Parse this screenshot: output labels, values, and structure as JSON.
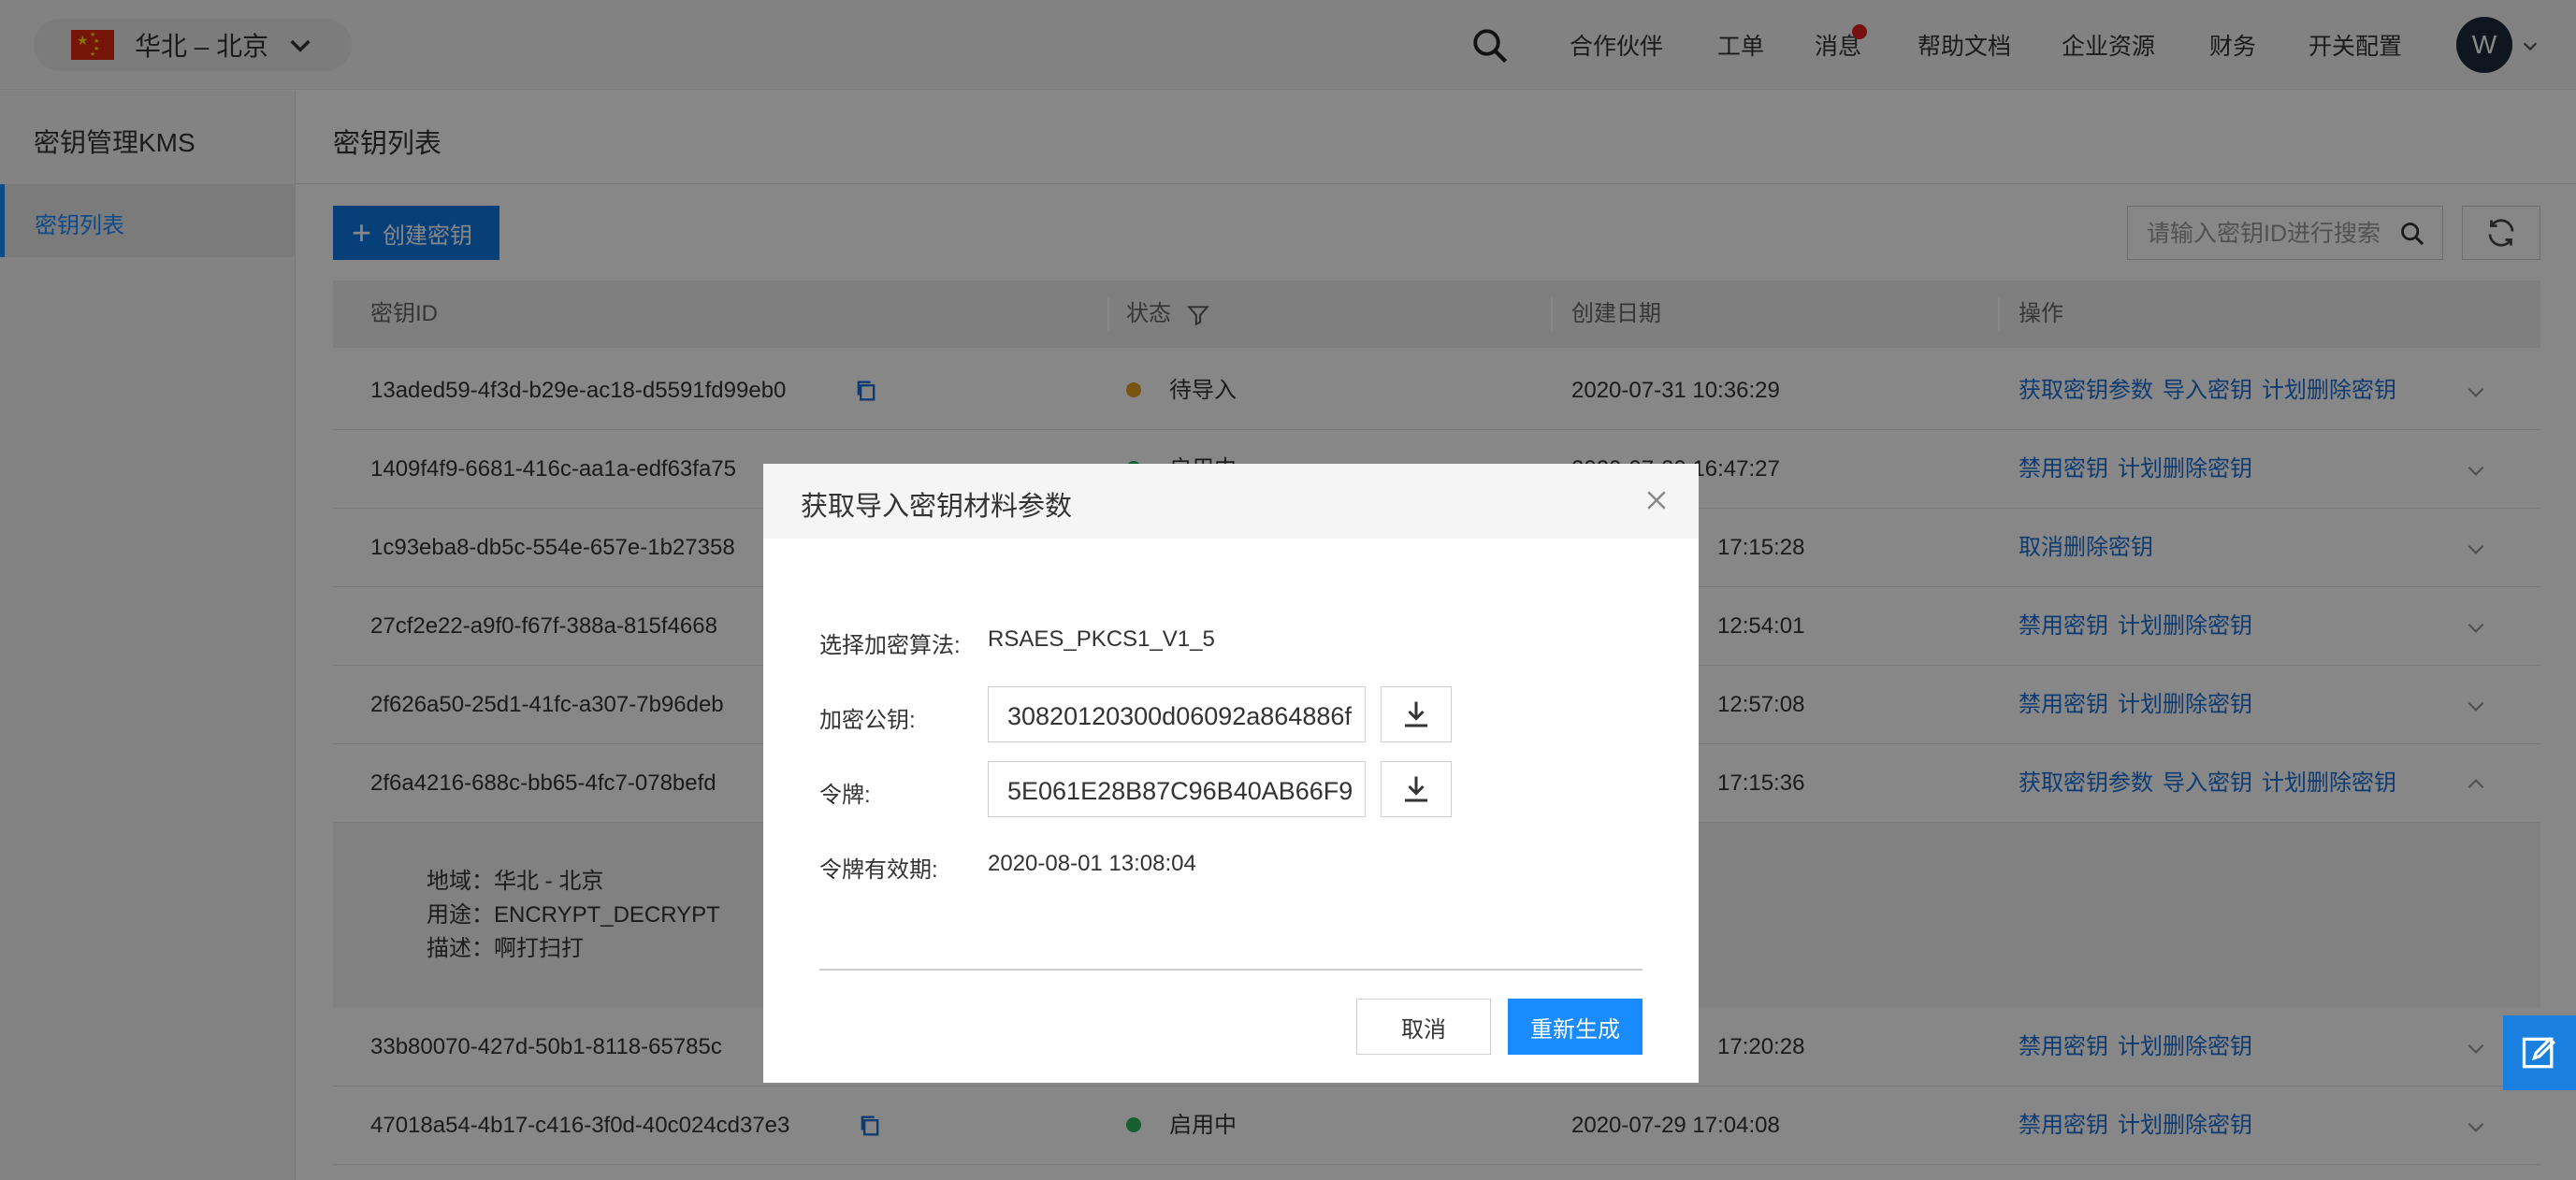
{
  "topbar": {
    "region": "华北 – 北京",
    "nav": [
      "合作伙伴",
      "工单",
      "消息",
      "帮助文档",
      "企业资源",
      "财务",
      "开关配置"
    ],
    "avatar_letter": "W"
  },
  "sidebar": {
    "title": "密钥管理KMS",
    "items": [
      {
        "label": "密钥列表"
      }
    ]
  },
  "main": {
    "page_title": "密钥列表",
    "create_button": "创建密钥",
    "search_placeholder": "请输入密钥ID进行搜索"
  },
  "table": {
    "headers": [
      "密钥ID",
      "状态",
      "创建日期",
      "操作"
    ],
    "rows": [
      {
        "id": "13aded59-4f3d-b29e-ac18-d5591fd99eb0",
        "status": "待导入",
        "status_color": "#e0a020",
        "date": "2020-07-31 10:36:29",
        "ops": [
          "获取密钥参数",
          "导入密钥",
          "计划删除密钥"
        ]
      },
      {
        "id": "1409f4f9-6681-416c-aa1a-edf63fa75",
        "status": "启用中",
        "status_color": "#2bb35a",
        "date": "2020-07-30 16:47:27",
        "ops": [
          "禁用密钥",
          "计划删除密钥"
        ]
      },
      {
        "id": "1c93eba8-db5c-554e-657e-1b27358",
        "status": "",
        "status_color": "",
        "date": "17:15:28",
        "ops": [
          "取消删除密钥"
        ]
      },
      {
        "id": "27cf2e22-a9f0-f67f-388a-815f4668",
        "status": "",
        "status_color": "",
        "date": "12:54:01",
        "ops": [
          "禁用密钥",
          "计划删除密钥"
        ]
      },
      {
        "id": "2f626a50-25d1-41fc-a307-7b96deb",
        "status": "",
        "status_color": "",
        "date": "12:57:08",
        "ops": [
          "禁用密钥",
          "计划删除密钥"
        ]
      },
      {
        "id": "2f6a4216-688c-bb65-4fc7-078befd",
        "status": "",
        "status_color": "",
        "date": "17:15:36",
        "ops": [
          "获取密钥参数",
          "导入密钥",
          "计划删除密钥"
        ]
      },
      {
        "id": "33b80070-427d-50b1-8118-65785c",
        "status": "",
        "status_color": "",
        "date": "17:20:28",
        "ops": [
          "禁用密钥",
          "计划删除密钥"
        ]
      },
      {
        "id": "47018a54-4b17-c416-3f0d-40c024cd37e3",
        "status": "启用中",
        "status_color": "#2bb35a",
        "date": "2020-07-29 17:04:08",
        "ops": [
          "禁用密钥",
          "计划删除密钥"
        ]
      }
    ],
    "expanded_detail": {
      "region": "地域：华北 - 北京",
      "usage": "用途：ENCRYPT_DECRYPT",
      "description": "描述：啊打扫打"
    }
  },
  "modal": {
    "title": "获取导入密钥材料参数",
    "algorithm_label": "选择加密算法:",
    "algorithm_value": "RSAES_PKCS1_V1_5",
    "public_key_label": "加密公钥:",
    "public_key_value": "30820120300d06092a864886f",
    "token_label": "令牌:",
    "token_value": "5E061E28B87C96B40AB66F9",
    "expiry_label": "令牌有效期:",
    "expiry_value": "2020-08-01 13:08:04",
    "cancel_label": "取消",
    "regenerate_label": "重新生成"
  },
  "colors": {
    "primary": "#1a8cff",
    "link": "#1a6fd6",
    "status_pending": "#e0a020",
    "status_enabled": "#2bb35a"
  }
}
